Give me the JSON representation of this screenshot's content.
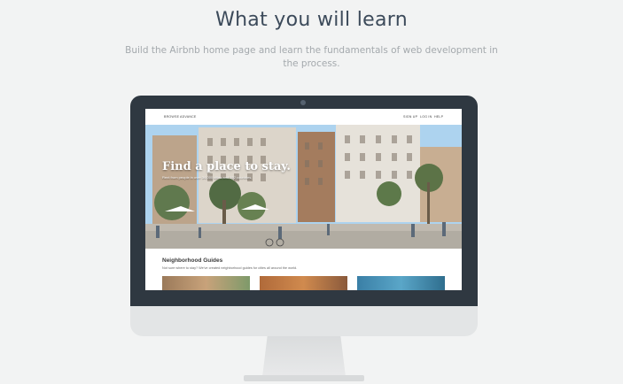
{
  "header": {
    "title": "What you will learn",
    "subtitle": "Build the Airbnb home page and learn the fundamentals of web development in the process."
  },
  "screen": {
    "nav_left": [
      "BROWSE",
      "ADVANCE"
    ],
    "nav_right": [
      "SIGN UP",
      "LOG IN",
      "HELP"
    ],
    "hero_headline": "Find a place to stay.",
    "hero_subtitle": "Rent from people in over 34,000 cities and 192 countries.",
    "guides_title": "Neighborhood Guides",
    "guides_description": "Not sure where to stay? We've created neighborhood guides for cities all around the world."
  },
  "colors": {
    "background": "#f2f3f3",
    "bezel": "#2f3841",
    "title": "#3c4a5a"
  }
}
